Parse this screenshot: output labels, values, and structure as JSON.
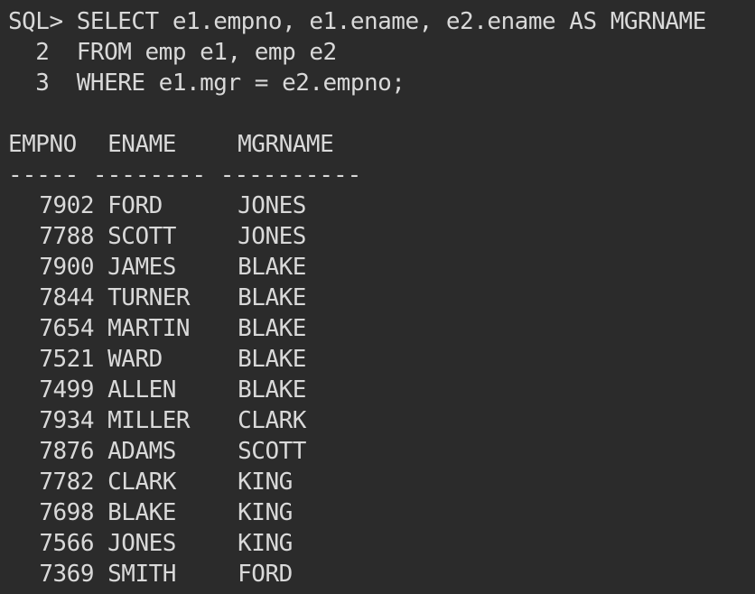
{
  "terminal": {
    "query_lines": [
      "SQL> SELECT e1.empno, e1.ename, e2.ename AS MGRNAME",
      "  2  FROM emp e1, emp e2",
      "  3  WHERE e1.mgr = e2.empno;"
    ],
    "columns": [
      "EMPNO",
      "ENAME",
      "MGRNAME"
    ],
    "separator": "----- -------- ----------",
    "rows": [
      {
        "empno": "7902",
        "ename": "FORD",
        "mgrname": "JONES"
      },
      {
        "empno": "7788",
        "ename": "SCOTT",
        "mgrname": "JONES"
      },
      {
        "empno": "7900",
        "ename": "JAMES",
        "mgrname": "BLAKE"
      },
      {
        "empno": "7844",
        "ename": "TURNER",
        "mgrname": "BLAKE"
      },
      {
        "empno": "7654",
        "ename": "MARTIN",
        "mgrname": "BLAKE"
      },
      {
        "empno": "7521",
        "ename": "WARD",
        "mgrname": "BLAKE"
      },
      {
        "empno": "7499",
        "ename": "ALLEN",
        "mgrname": "BLAKE"
      },
      {
        "empno": "7934",
        "ename": "MILLER",
        "mgrname": "CLARK"
      },
      {
        "empno": "7876",
        "ename": "ADAMS",
        "mgrname": "SCOTT"
      },
      {
        "empno": "7782",
        "ename": "CLARK",
        "mgrname": "KING"
      },
      {
        "empno": "7698",
        "ename": "BLAKE",
        "mgrname": "KING"
      },
      {
        "empno": "7566",
        "ename": "JONES",
        "mgrname": "KING"
      },
      {
        "empno": "7369",
        "ename": "SMITH",
        "mgrname": "FORD"
      }
    ]
  }
}
